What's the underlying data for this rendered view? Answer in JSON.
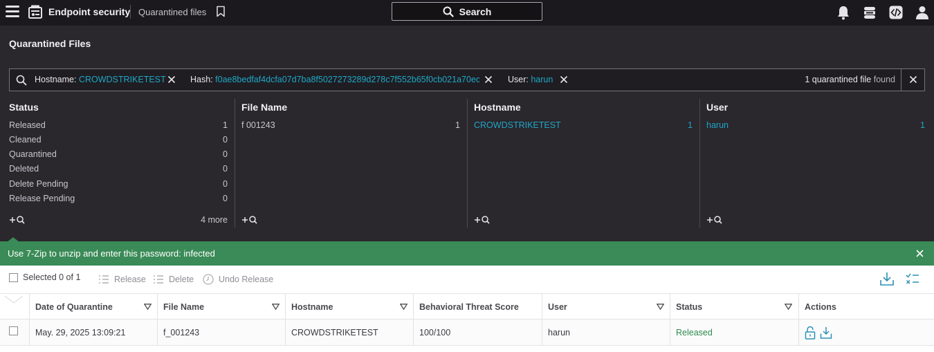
{
  "header": {
    "app_title": "Endpoint security",
    "crumb": "Quarantined files",
    "search_label": "Search"
  },
  "page": {
    "title": "Quarantined Files"
  },
  "filters": {
    "chips": [
      {
        "key": "Hostname",
        "value": "CROWDSTRIKETEST"
      },
      {
        "key": "Hash",
        "value": "f0ae8bedfaf4dcfa07d7ba8f5027273289d278c7f552b65f0cb021a70ec"
      },
      {
        "key": "User",
        "value": "harun"
      }
    ],
    "found_count": "1",
    "found_middle": "quarantined file",
    "found_suffix": "found"
  },
  "facets": {
    "status": {
      "title": "Status",
      "rows": [
        {
          "label": "Released",
          "count": "1"
        },
        {
          "label": "Cleaned",
          "count": "0"
        },
        {
          "label": "Quarantined",
          "count": "0"
        },
        {
          "label": "Deleted",
          "count": "0"
        },
        {
          "label": "Delete Pending",
          "count": "0"
        },
        {
          "label": "Release Pending",
          "count": "0"
        }
      ],
      "more": "4 more"
    },
    "file_name": {
      "title": "File Name",
      "rows": [
        {
          "label": "f 001243",
          "count": "1"
        }
      ]
    },
    "hostname": {
      "title": "Hostname",
      "rows": [
        {
          "label": "CROWDSTRIKETEST",
          "count": "1"
        }
      ]
    },
    "user": {
      "title": "User",
      "rows": [
        {
          "label": "harun",
          "count": "1"
        }
      ]
    }
  },
  "notice": {
    "text": "Use 7-Zip to unzip and enter this password: infected"
  },
  "toolbar": {
    "selected": "Selected 0 of 1",
    "release": "Release",
    "delete": "Delete",
    "undo_release": "Undo Release"
  },
  "table": {
    "columns": [
      "Date of Quarantine",
      "File Name",
      "Hostname",
      "Behavioral Threat Score",
      "User",
      "Status",
      "Actions"
    ],
    "rows": [
      {
        "date": "May. 29, 2025 13:09:21",
        "file_name": "f_001243",
        "hostname": "CROWDSTRIKETEST",
        "score": "100/100",
        "user": "harun",
        "status": "Released"
      }
    ]
  },
  "colors": {
    "accent_link": "#1fa7c6",
    "banner": "#3a8b57",
    "released": "#2f8a4c",
    "header_bg": "#1b191d",
    "panel_bg": "#2a272d"
  }
}
